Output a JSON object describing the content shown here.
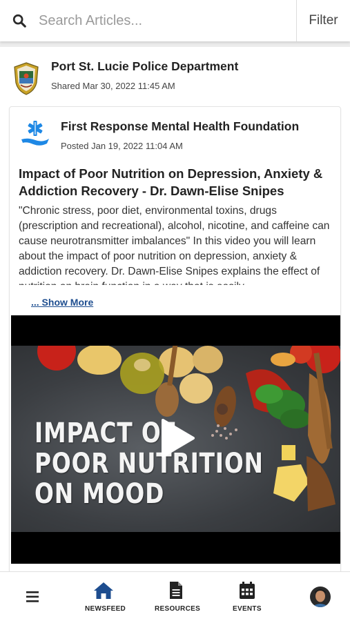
{
  "search": {
    "placeholder": "Search Articles...",
    "value": "",
    "filter_label": "Filter"
  },
  "post": {
    "org_name": "Port St. Lucie Police Department",
    "shared_date": "Shared Mar 30, 2022 11:45 AM",
    "shared": {
      "org_name": "First Response Mental Health Foundation",
      "posted_date": "Posted Jan 19, 2022 11:04 AM",
      "title_lines": [
        "Impact of Poor Nutrition on Depression, Anxiety &",
        "Addiction Recovery - Dr. Dawn-Elise Snipes"
      ],
      "body": " \"Chronic stress, poor diet, environmental toxins, drugs (prescription and recreational), alcohol, nicotine, and caffeine can cause neurotransmitter imbalances\" In this video you will learn about the impact of poor nutrition on depression, anxiety & addiction recovery. Dr. Dawn-Elise Snipes explains the effect of nutrition on brain function in a way that is easily",
      "show_more": "... Show More",
      "video": {
        "thumbnail_text": [
          "IMPACT OF",
          "POOR NUTRITION",
          "ON MOOD"
        ]
      }
    }
  },
  "bottom_nav": {
    "items": [
      {
        "label": "NEWSFEED",
        "icon": "home-icon"
      },
      {
        "label": "RESOURCES",
        "icon": "document-icon"
      },
      {
        "label": "EVENTS",
        "icon": "calendar-icon"
      }
    ],
    "menu_icon": "hamburger-menu-icon",
    "avatar_icon": "user-avatar"
  },
  "colors": {
    "nav_active": "#1d4d8f",
    "link": "#1d4d8f",
    "foundation_blue": "#1e88e5"
  }
}
